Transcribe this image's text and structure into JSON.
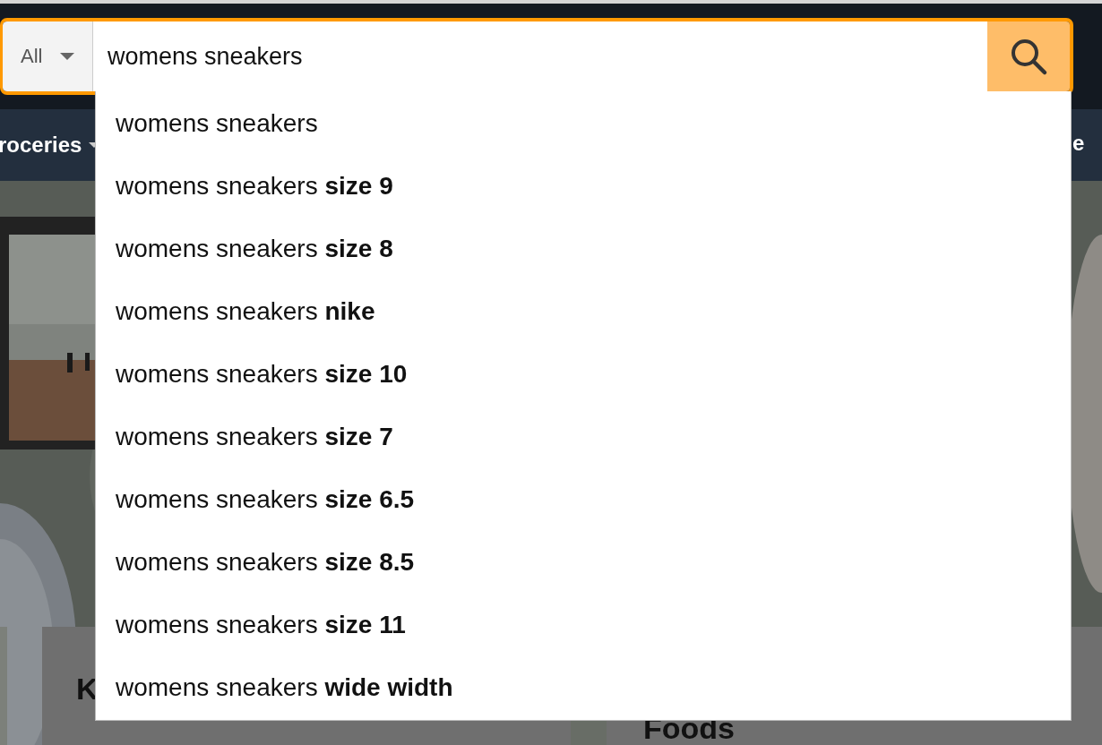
{
  "search": {
    "category": "All",
    "query": "womens sneakers"
  },
  "nav": {
    "left_item": "roceries",
    "right_item": "e"
  },
  "suggestions": [
    "womens sneakers",
    "womens sneakers **size 9**",
    "womens sneakers **size 8**",
    "womens sneakers **nike**",
    "womens sneakers **size 10**",
    "womens sneakers **size 7**",
    "womens sneakers **size 6.5**",
    "womens sneakers **size 8.5**",
    "womens sneakers **size 11**",
    "womens sneakers **wide width**"
  ],
  "cards": [
    {
      "title": "K"
    },
    {
      "title": "Foods"
    }
  ]
}
